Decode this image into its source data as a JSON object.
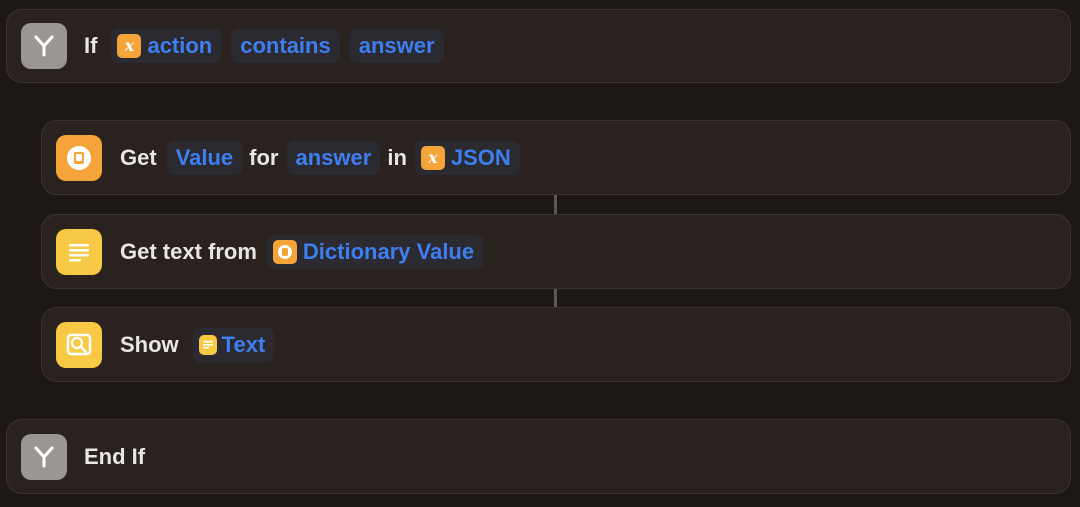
{
  "if_block": {
    "keyword": "If",
    "variable": "action",
    "operator": "contains",
    "value": "answer"
  },
  "get_value_action": {
    "verb": "Get",
    "key_type": "Value",
    "for_word": "for",
    "key": "answer",
    "in_word": "in",
    "source": "JSON"
  },
  "get_text_action": {
    "label": "Get text from",
    "input": "Dictionary Value"
  },
  "show_action": {
    "label": "Show",
    "input": "Text"
  },
  "end_if": {
    "label": "End If"
  },
  "icons": {
    "branch": "branch-icon",
    "dictionary": "dictionary-icon",
    "text": "text-lines-icon",
    "show": "show-result-icon",
    "variable": "variable-x-icon"
  },
  "colors": {
    "background": "#1d1816",
    "card": "#29221f",
    "token_text": "#3d7ef0",
    "orange_icon": "#f5a43a",
    "yellow_icon": "#f7c945",
    "gray_icon": "#9a9694"
  }
}
